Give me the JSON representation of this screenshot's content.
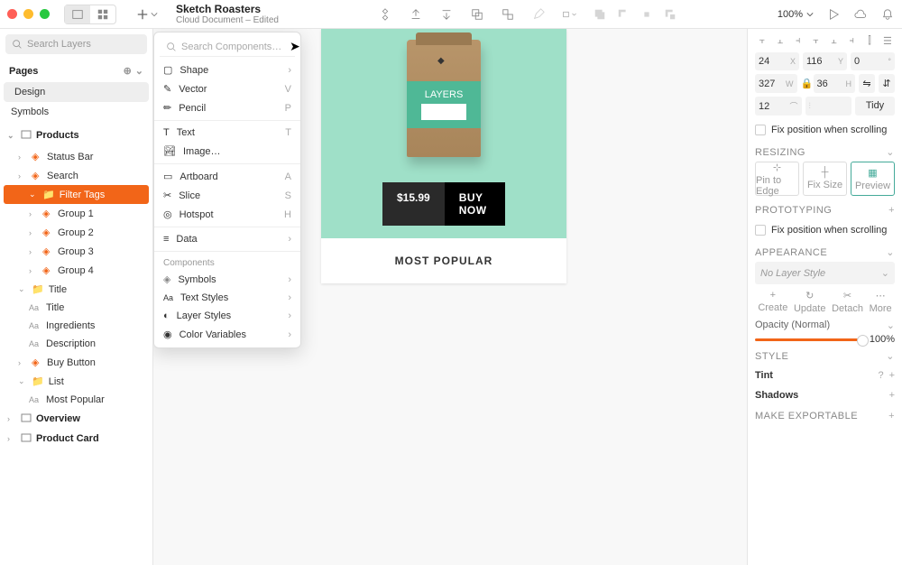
{
  "header": {
    "title": "Sketch Roasters",
    "subtitle": "Cloud Document – Edited",
    "zoom": "100%"
  },
  "left": {
    "search_placeholder": "Search Layers",
    "pages_label": "Pages",
    "pages": [
      "Design",
      "Symbols"
    ],
    "section": "Products",
    "layers": {
      "status_bar": "Status Bar",
      "search": "Search",
      "filter_tags": "Filter Tags",
      "group1": "Group 1",
      "group2": "Group 2",
      "group3": "Group 3",
      "group4": "Group 4",
      "title": "Title",
      "title_txt": "Title",
      "ingredients": "Ingredients",
      "description": "Description",
      "buy_button": "Buy Button",
      "list": "List",
      "most_popular": "Most Popular",
      "overview": "Overview",
      "product_card": "Product Card"
    }
  },
  "insert_menu": {
    "search_placeholder": "Search Components…",
    "items": {
      "shape": "Shape",
      "vector": {
        "label": "Vector",
        "key": "V"
      },
      "pencil": {
        "label": "Pencil",
        "key": "P"
      },
      "text": {
        "label": "Text",
        "key": "T"
      },
      "image": "Image…",
      "artboard": {
        "label": "Artboard",
        "key": "A"
      },
      "slice": {
        "label": "Slice",
        "key": "S"
      },
      "hotspot": {
        "label": "Hotspot",
        "key": "H"
      },
      "data": "Data",
      "components_head": "Components",
      "symbols": "Symbols",
      "text_styles": "Text Styles",
      "layer_styles": "Layer Styles",
      "color_vars": "Color Variables"
    }
  },
  "canvas": {
    "bag_label": "LAYERS",
    "price": "$15.99",
    "buy": "BUY NOW",
    "popular": "MOST POPULAR"
  },
  "right": {
    "x": "24",
    "y": "116",
    "deg": "0",
    "w": "327",
    "h": "36",
    "radius": "12",
    "tidy": "Tidy",
    "fix_scroll": "Fix position when scrolling",
    "resizing": "RESIZING",
    "pin": "Pin to Edge",
    "fixsize": "Fix Size",
    "preview": "Preview",
    "prototyping": "PROTOTYPING",
    "appearance": "APPEARANCE",
    "no_layer_style": "No Layer Style",
    "create": "Create",
    "update": "Update",
    "detach": "Detach",
    "more": "More",
    "opacity_label": "Opacity (Normal)",
    "opacity_val": "100%",
    "style": "STYLE",
    "tint": "Tint",
    "shadows": "Shadows",
    "make_exportable": "MAKE EXPORTABLE"
  }
}
